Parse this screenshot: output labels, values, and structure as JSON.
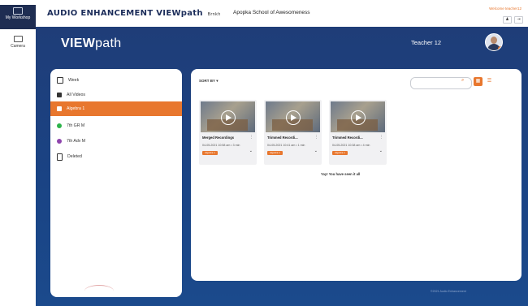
{
  "left_rail": {
    "workshop_label": "My Workshop",
    "camera_label": "Camera"
  },
  "topbar": {
    "brand": "AUDIO ENHANCEMENT VIEWpath",
    "brand_sub": "Brnkh",
    "school": "Apopka School of Awesomeness",
    "welcome": "Welcome teacher12"
  },
  "header": {
    "logo_bold": "VIEW",
    "logo_light": "path",
    "teacher_name": "Teacher 12"
  },
  "sidebar": {
    "items": [
      {
        "label": "Week",
        "icon_color": "#333333"
      },
      {
        "label": "All Videos",
        "icon_color": "#333333"
      },
      {
        "label": "Algebra 1",
        "icon_color": "#ffffff",
        "active": true
      },
      {
        "label": "7th GR M",
        "icon_color": "#2cb34a"
      },
      {
        "label": "7th Adv M",
        "icon_color": "#8e44ad"
      },
      {
        "label": "Deleted",
        "icon_color": "#333333"
      }
    ]
  },
  "content": {
    "sort_label": "SORT BY",
    "end_message": "Yay! You have seen it all",
    "cards": [
      {
        "title": "Merged Recordings",
        "date": "04-05-2021 10:58 am • 3 min",
        "tag": "Algebra 1"
      },
      {
        "title": "Trimmed Recordi...",
        "date": "04-05-2021 10:41 am • 1 min",
        "tag": "Algebra 1"
      },
      {
        "title": "Trimmed Recordi...",
        "date": "04-05-2021 10:38 am • 4 min",
        "tag": "Algebra 1"
      }
    ]
  },
  "footer": {
    "copyright": "©2021 Audio Enhancement"
  },
  "colors": {
    "accent": "#e8772e",
    "navy": "#1f3d78"
  }
}
